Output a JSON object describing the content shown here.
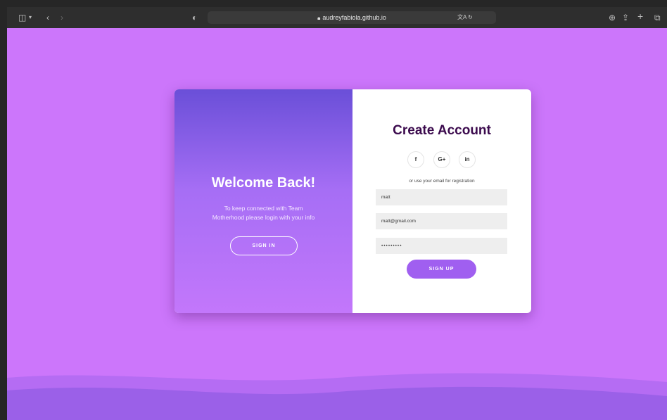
{
  "browser": {
    "url": "audreyfabiola.github.io",
    "icons": [
      "sidebar-icon",
      "chevron-down-icon",
      "back-icon",
      "forward-icon",
      "shield-icon",
      "lock-icon",
      "translate-icon",
      "reload-icon",
      "download-icon",
      "share-icon",
      "plus-icon",
      "tabs-icon"
    ]
  },
  "overlay": {
    "title": "Welcome Back!",
    "text_line1": "To keep connected with Team",
    "text_line2": "Motherhood please login with your info",
    "sign_in_label": "SIGN IN"
  },
  "form": {
    "title": "Create Account",
    "socials": [
      {
        "label": "f",
        "icon": "facebook-icon"
      },
      {
        "label": "G+",
        "icon": "google-plus-icon"
      },
      {
        "label": "in",
        "icon": "linkedin-icon"
      }
    ],
    "hint": "or use your email for registration",
    "name_value": "matt",
    "email_value": "matt@gmail.com",
    "password_value": "•••••••••",
    "sign_up_label": "SIGN UP"
  },
  "colors": {
    "page_bg": "#cc76fb",
    "overlay_top": "#6a4fd8",
    "overlay_bottom": "#c377fb",
    "title_color": "#3b0a4d",
    "button_color": "#a05ff0",
    "wave_color": "#9b60e8"
  }
}
